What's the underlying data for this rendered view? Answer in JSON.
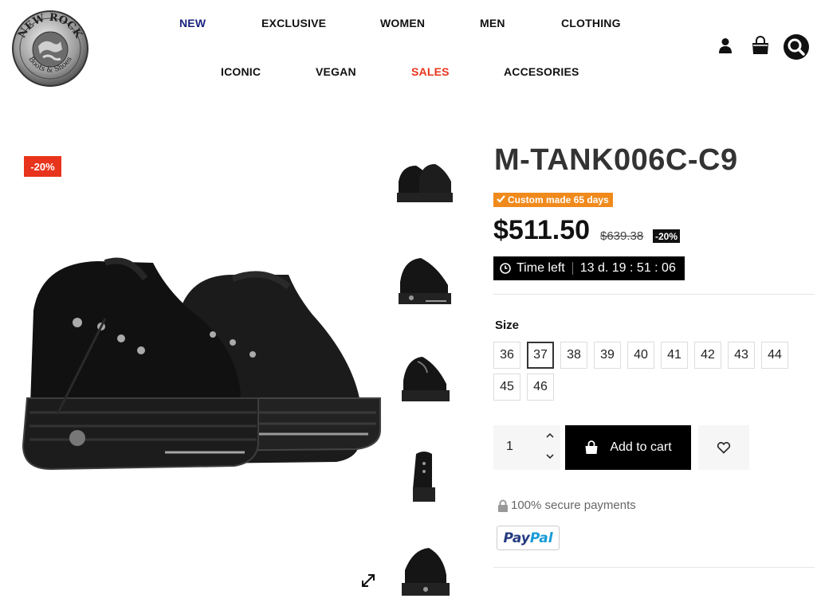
{
  "brand": {
    "logo_text_top": "NEW ROCK",
    "logo_text_bottom": "Boots & Shoes"
  },
  "nav": {
    "row1": [
      "NEW",
      "EXCLUSIVE",
      "WOMEN",
      "MEN",
      "CLOTHING"
    ],
    "row2": [
      "ICONIC",
      "VEGAN",
      "SALES",
      "ACCESORIES"
    ]
  },
  "header_icons": [
    "user-icon",
    "shopping-bag-icon",
    "search-icon"
  ],
  "colors": {
    "nav_new": "#1a237e",
    "nav_sales": "#e8341c",
    "discount": "#e8341c",
    "custom_badge": "#f08a1c",
    "button": "#000000"
  },
  "gallery": {
    "discount_tag": "-20%",
    "thumbnail_count": 5
  },
  "product": {
    "title": "M-TANK006C-C9",
    "custom_badge": "Custom made 65 days",
    "price": "$511.50",
    "old_price": "$639.38",
    "discount": "-20%",
    "timer_label": "Time left",
    "timer_value": "13 d. 19 : 51 : 06",
    "size_label": "Size",
    "sizes": [
      "36",
      "37",
      "38",
      "39",
      "40",
      "41",
      "42",
      "43",
      "44",
      "45",
      "46"
    ],
    "selected_size": "37",
    "quantity": "1",
    "add_to_cart": "Add to cart",
    "secure_text": "100% secure payments",
    "paypal_a": "Pay",
    "paypal_b": "Pal"
  }
}
